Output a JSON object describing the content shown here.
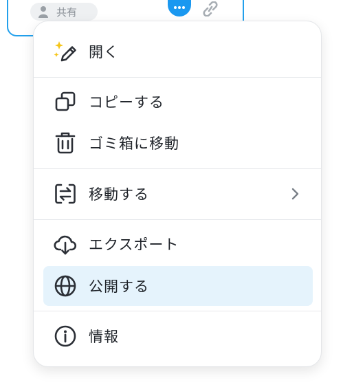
{
  "card": {
    "share_label": "共有"
  },
  "menu": {
    "items": [
      {
        "label": "開く",
        "icon": "sparkle-pencil-icon"
      },
      {
        "label": "コピーする",
        "icon": "copy-icon"
      },
      {
        "label": "ゴミ箱に移動",
        "icon": "trash-icon"
      },
      {
        "label": "移動する",
        "icon": "move-icon",
        "has_submenu": true
      },
      {
        "label": "エクスポート",
        "icon": "cloud-download-icon"
      },
      {
        "label": "公開する",
        "icon": "globe-icon",
        "highlighted": true
      },
      {
        "label": "情報",
        "icon": "info-icon"
      }
    ]
  },
  "colors": {
    "accent": "#1a98f0",
    "highlight_bg": "#e5f3fc",
    "text": "#1f2329",
    "icon": "#2b2f36",
    "sparkle": "#f5c518"
  }
}
